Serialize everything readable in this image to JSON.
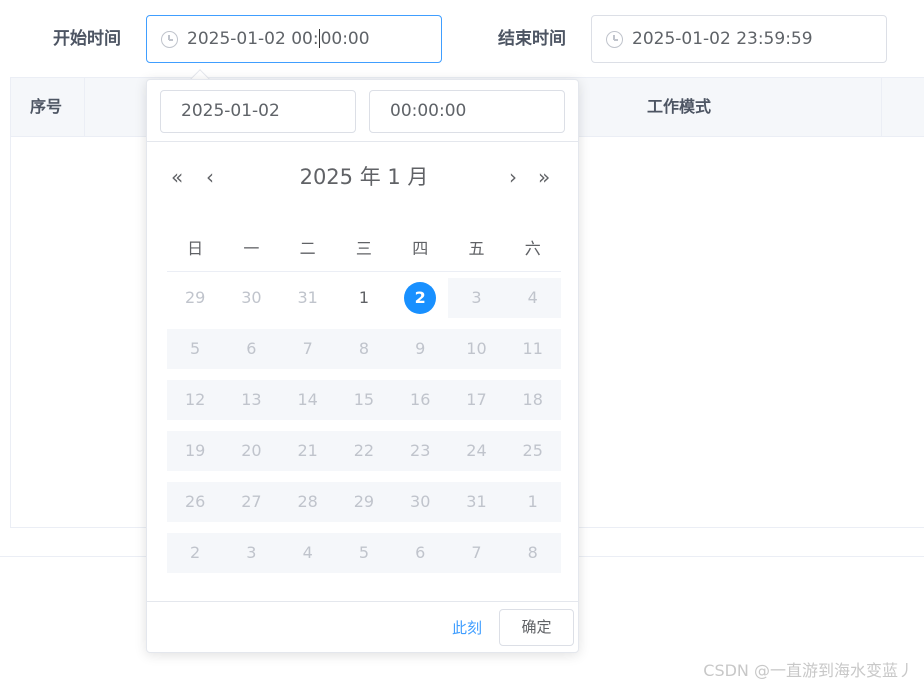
{
  "form": {
    "start_label": "开始时间",
    "start_value_before_caret": "2025-01-02 00:",
    "start_value_after_caret": "00:00",
    "end_label": "结束时间",
    "end_value": "2025-01-02 23:59:59"
  },
  "table": {
    "headers": [
      "序号",
      "工作模式"
    ]
  },
  "picker": {
    "date_input": "2025-01-02",
    "time_input": "00:00:00",
    "nav": {
      "prev_year": "«",
      "prev_month": "‹",
      "title": "2025 年  1 月",
      "next_month": "›",
      "next_year": "»"
    },
    "weekdays": [
      "日",
      "一",
      "二",
      "三",
      "四",
      "五",
      "六"
    ],
    "weeks": [
      [
        {
          "d": "29",
          "s": "other"
        },
        {
          "d": "30",
          "s": "other"
        },
        {
          "d": "31",
          "s": "other"
        },
        {
          "d": "1",
          "s": "available"
        },
        {
          "d": "2",
          "s": "selected"
        },
        {
          "d": "3",
          "s": "disabled"
        },
        {
          "d": "4",
          "s": "disabled"
        }
      ],
      [
        {
          "d": "5",
          "s": "disabled"
        },
        {
          "d": "6",
          "s": "disabled"
        },
        {
          "d": "7",
          "s": "disabled"
        },
        {
          "d": "8",
          "s": "disabled"
        },
        {
          "d": "9",
          "s": "disabled"
        },
        {
          "d": "10",
          "s": "disabled"
        },
        {
          "d": "11",
          "s": "disabled"
        }
      ],
      [
        {
          "d": "12",
          "s": "disabled"
        },
        {
          "d": "13",
          "s": "disabled"
        },
        {
          "d": "14",
          "s": "disabled"
        },
        {
          "d": "15",
          "s": "disabled"
        },
        {
          "d": "16",
          "s": "disabled"
        },
        {
          "d": "17",
          "s": "disabled"
        },
        {
          "d": "18",
          "s": "disabled"
        }
      ],
      [
        {
          "d": "19",
          "s": "disabled"
        },
        {
          "d": "20",
          "s": "disabled"
        },
        {
          "d": "21",
          "s": "disabled"
        },
        {
          "d": "22",
          "s": "disabled"
        },
        {
          "d": "23",
          "s": "disabled"
        },
        {
          "d": "24",
          "s": "disabled"
        },
        {
          "d": "25",
          "s": "disabled"
        }
      ],
      [
        {
          "d": "26",
          "s": "disabled"
        },
        {
          "d": "27",
          "s": "disabled"
        },
        {
          "d": "28",
          "s": "disabled"
        },
        {
          "d": "29",
          "s": "disabled"
        },
        {
          "d": "30",
          "s": "disabled"
        },
        {
          "d": "31",
          "s": "disabled"
        },
        {
          "d": "1",
          "s": "disabled"
        }
      ],
      [
        {
          "d": "2",
          "s": "disabled"
        },
        {
          "d": "3",
          "s": "disabled"
        },
        {
          "d": "4",
          "s": "disabled"
        },
        {
          "d": "5",
          "s": "disabled"
        },
        {
          "d": "6",
          "s": "disabled"
        },
        {
          "d": "7",
          "s": "disabled"
        },
        {
          "d": "8",
          "s": "disabled"
        }
      ]
    ],
    "now_label": "此刻",
    "confirm_label": "确定"
  },
  "watermark": "CSDN @一直游到海水变蓝丿",
  "icons": {
    "input_prefix": "clock-icon"
  },
  "colors": {
    "accent": "#409eff",
    "selected_day": "#1890ff",
    "label": "#4d5563",
    "disabled_bg": "#f5f7fa"
  }
}
